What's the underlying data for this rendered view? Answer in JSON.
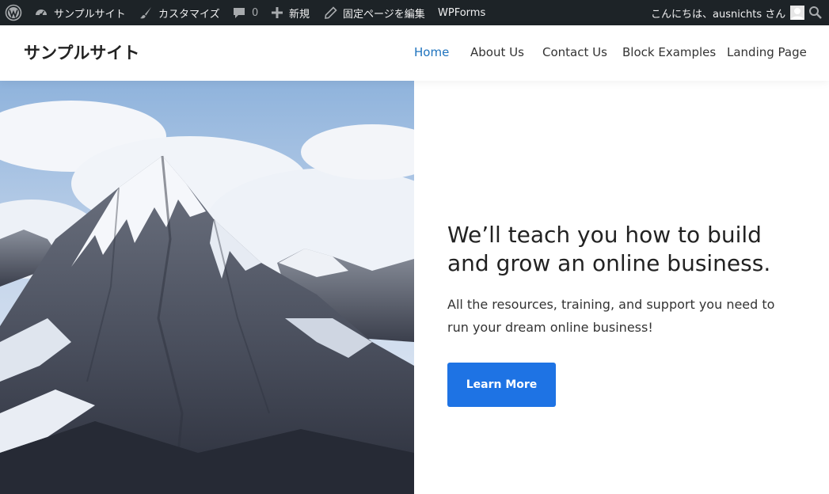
{
  "admin_bar": {
    "site_name": "サンプルサイト",
    "customize": "カスタマイズ",
    "comments_count": "0",
    "new": "新規",
    "edit_page": "固定ページを編集",
    "wpforms": "WPForms",
    "greeting": "こんにちは、ausnichts さん",
    "icons": [
      "wordpress-logo-icon",
      "dashboard-icon",
      "brush-icon",
      "comment-icon",
      "plus-icon",
      "pencil-icon",
      "avatar-icon",
      "search-icon"
    ]
  },
  "header": {
    "site_title": "サンプルサイト",
    "nav": [
      {
        "label": "Home",
        "active": true
      },
      {
        "label": "About Us",
        "active": false
      },
      {
        "label": "Contact Us",
        "active": false
      },
      {
        "label": "Block Examples",
        "active": false
      },
      {
        "label": "Landing Page",
        "active": false
      }
    ]
  },
  "hero": {
    "heading": "We’ll teach you how to build and grow an online business.",
    "text": "All the resources, training, and support you need to run your dream online business!",
    "button_label": "Learn More",
    "image": "snow-capped-mountain-photo"
  },
  "colors": {
    "admin_bar_bg": "#1d2327",
    "nav_active": "#1e73be",
    "button_bg": "#1e73e4"
  }
}
